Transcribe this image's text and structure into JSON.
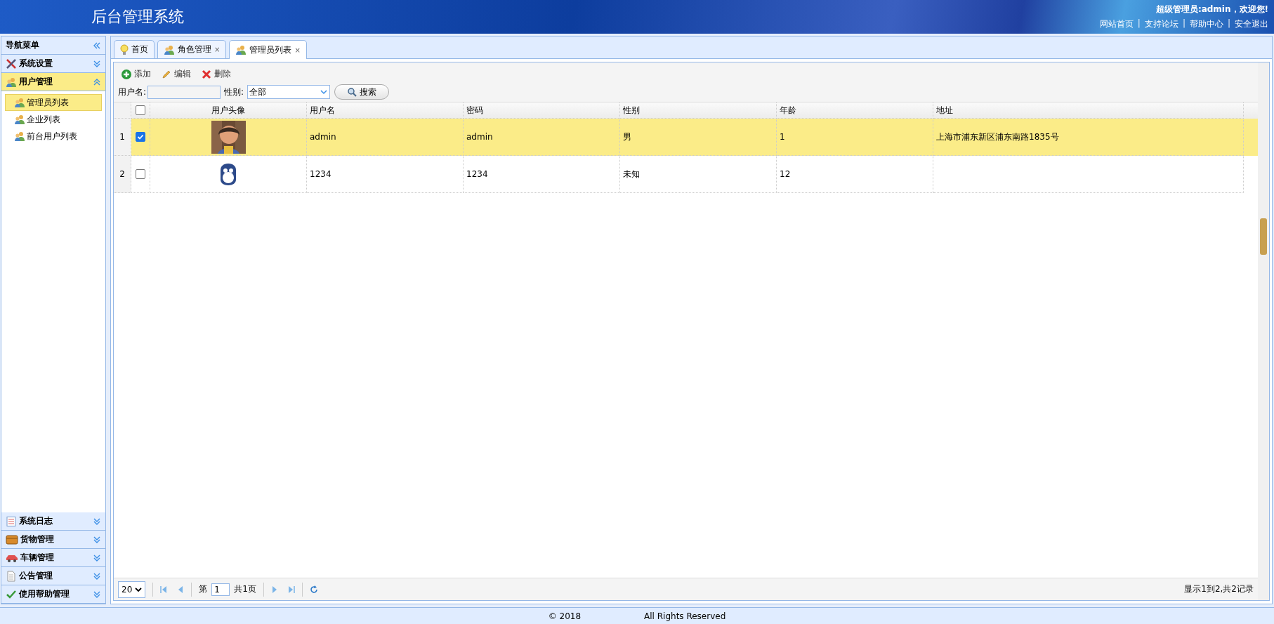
{
  "header": {
    "title": "后台管理系统",
    "greeting": "超级管理员:admin，欢迎您!",
    "separator": "|",
    "links": [
      "网站首页",
      "支持论坛",
      "帮助中心",
      "安全退出"
    ]
  },
  "sidebar": {
    "title": "导航菜单",
    "groups": [
      {
        "label": "系统设置",
        "expanded": false
      },
      {
        "label": "用户管理",
        "expanded": true,
        "children": [
          {
            "label": "管理员列表",
            "selected": true
          },
          {
            "label": "企业列表",
            "selected": false
          },
          {
            "label": "前台用户列表",
            "selected": false
          }
        ]
      },
      {
        "label": "系统日志",
        "expanded": false
      },
      {
        "label": "货物管理",
        "expanded": false
      },
      {
        "label": "车辆管理",
        "expanded": false
      },
      {
        "label": "公告管理",
        "expanded": false
      },
      {
        "label": "使用帮助管理",
        "expanded": false
      }
    ]
  },
  "tabs": [
    {
      "label": "首页",
      "selected": false
    },
    {
      "label": "角色管理",
      "selected": false,
      "close": "×"
    },
    {
      "label": "管理员列表",
      "selected": true,
      "close": "×"
    }
  ],
  "toolbar": [
    "添加",
    "编辑",
    "删除"
  ],
  "search": {
    "username_label": "用户名:",
    "gender_label": "性别:",
    "gender_value": "全部",
    "button": "搜索"
  },
  "table": {
    "columns": [
      "用户头像",
      "用户名",
      "密码",
      "性别",
      "年龄",
      "地址"
    ],
    "header_checked": false,
    "rows": [
      {
        "index": "1",
        "checked": true,
        "selected": true,
        "cells": [
          "",
          "admin",
          "admin",
          "男",
          "1",
          "上海市浦东新区浦东南路1835号"
        ]
      },
      {
        "index": "2",
        "checked": false,
        "selected": false,
        "cells": [
          "",
          "1234",
          "1234",
          "未知",
          "12",
          ""
        ]
      }
    ]
  },
  "pager": {
    "page_size": "20",
    "page_prefix": "第",
    "page": "1",
    "page_suffix": "共1页",
    "summary": "显示1到2,共2记录"
  },
  "footer": {
    "copyright": "© 2018",
    "rights": "All Rights Reserved"
  }
}
